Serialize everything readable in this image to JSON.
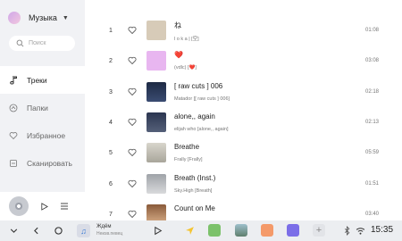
{
  "app": {
    "title": "Музыка"
  },
  "search": {
    "placeholder": "Поиск"
  },
  "nav": {
    "items": [
      {
        "label": "Треки",
        "icon": "music-note-icon",
        "active": true
      },
      {
        "label": "Папки",
        "icon": "folder-icon",
        "active": false
      },
      {
        "label": "Избранное",
        "icon": "heart-icon",
        "active": false
      },
      {
        "label": "Сканировать",
        "icon": "scan-icon",
        "active": false
      }
    ]
  },
  "tracks": [
    {
      "num": "1",
      "title": "ね",
      "artist": "l o k a | [空]",
      "duration": "01:08",
      "cover": "#d7cbb8",
      "favorite": false
    },
    {
      "num": "2",
      "title": "❤️",
      "artist": "(vdlc) [❤️]",
      "duration": "03:08",
      "cover": "#e8b6f0",
      "favorite": false
    },
    {
      "num": "3",
      "title": "[ raw cuts ] 006",
      "artist": "Matador [[ raw cuts ] 006]",
      "duration": "02:18",
      "cover": "#2a3b5c",
      "favorite": false
    },
    {
      "num": "4",
      "title": "alone,, again",
      "artist": "elijah who [alone,, again]",
      "duration": "02:13",
      "cover": "#3a4660",
      "favorite": false
    },
    {
      "num": "5",
      "title": "Breathe",
      "artist": "Frally [Frally]",
      "duration": "05:59",
      "cover": "#c9c5b9",
      "favorite": false
    },
    {
      "num": "6",
      "title": "Breath (Inst.)",
      "artist": "Sky.High [Breath]",
      "duration": "01:51",
      "cover": "#b9bcc0",
      "favorite": false
    },
    {
      "num": "7",
      "title": "Count on Me",
      "artist": "",
      "duration": "03:40",
      "cover": "#b48a6a",
      "favorite": false
    }
  ],
  "taskbar": {
    "media_title": "Ждём",
    "media_artist": "Неизв.певец",
    "time": "15:35",
    "apps": [
      {
        "icon": "navigation-icon",
        "color": "#f4c430"
      },
      {
        "icon": "game-app-icon",
        "color": "#7cc26b"
      },
      {
        "icon": "gallery-app-icon",
        "color": "#7fa6b3"
      },
      {
        "icon": "music-app-icon",
        "color": "#f49a6a"
      },
      {
        "icon": "video-app-icon",
        "color": "#7b6ee8"
      }
    ]
  },
  "colors": {
    "accent": "#e43b3b",
    "sidebar_bg": "#f1f2f5",
    "taskbar_bg": "#eceef1"
  }
}
